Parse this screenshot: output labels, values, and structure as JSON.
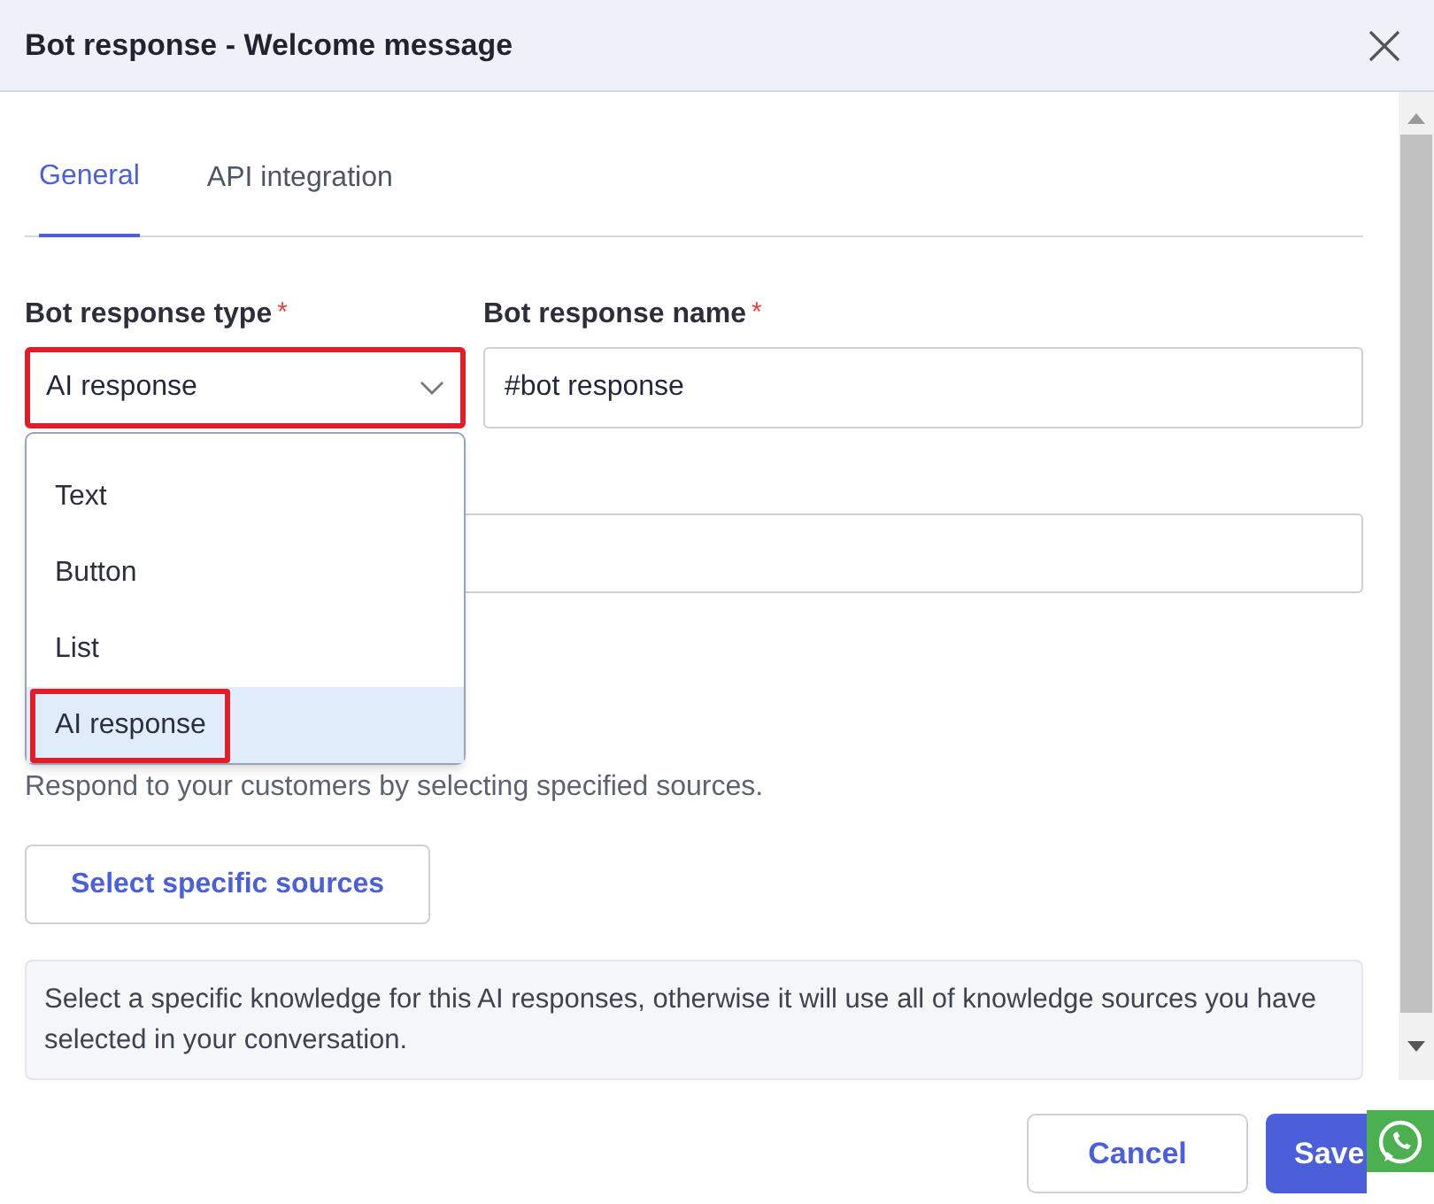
{
  "dialog": {
    "title": "Bot response - Welcome message"
  },
  "tabs": [
    {
      "label": "General",
      "selected": true
    },
    {
      "label": "API integration",
      "selected": false
    }
  ],
  "fields": [
    {
      "label": "Bot response type",
      "required": true,
      "required_mark": "*",
      "value": "AI response",
      "highlighted": true,
      "kind": "select"
    },
    {
      "label": "Bot response name",
      "required": true,
      "required_mark": "*",
      "value": "#bot response",
      "highlighted": false,
      "kind": "text"
    }
  ],
  "dropdown": {
    "options": [
      {
        "label": "Text",
        "selected": false,
        "highlighted": false
      },
      {
        "label": "Button",
        "selected": false,
        "highlighted": false
      },
      {
        "label": "List",
        "selected": false,
        "highlighted": false
      },
      {
        "label": "AI response",
        "selected": true,
        "highlighted": true
      }
    ]
  },
  "description": "Respond to your customers by selecting specified sources.",
  "sources_button": "Select specific sources",
  "note": "Select a specific knowledge for this AI responses, otherwise it will use all of knowledge sources you have selected in your conversation.",
  "buttons": [
    {
      "label": "Cancel",
      "kind": "secondary"
    },
    {
      "label": "Save",
      "kind": "primary"
    }
  ]
}
